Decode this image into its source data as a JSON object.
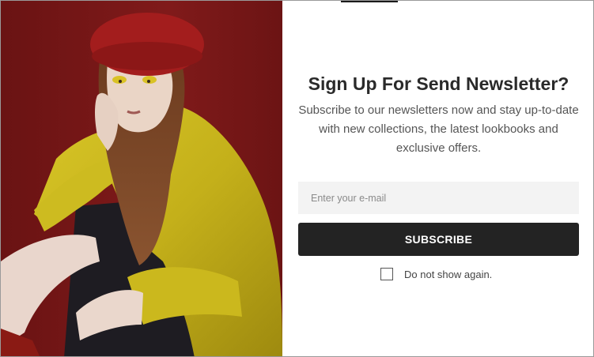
{
  "newsletter": {
    "title": "Sign Up For Send Newsletter?",
    "description": "Subscribe to our newsletters now and stay up-to-date with new collections, the latest lookbooks and exclusive offers.",
    "email_placeholder": "Enter your e-mail",
    "email_value": "",
    "subscribe_label": "SUBSCRIBE",
    "dont_show_label": "Do not show again.",
    "dont_show_checked": false
  },
  "colors": {
    "background_red": "#7d1919",
    "button_dark": "#232323",
    "input_bg": "#f3f3f3",
    "coat_yellow": "#c9b81c",
    "hat_red": "#a51e1e"
  },
  "image": {
    "icon": "fashion-model-photo"
  }
}
